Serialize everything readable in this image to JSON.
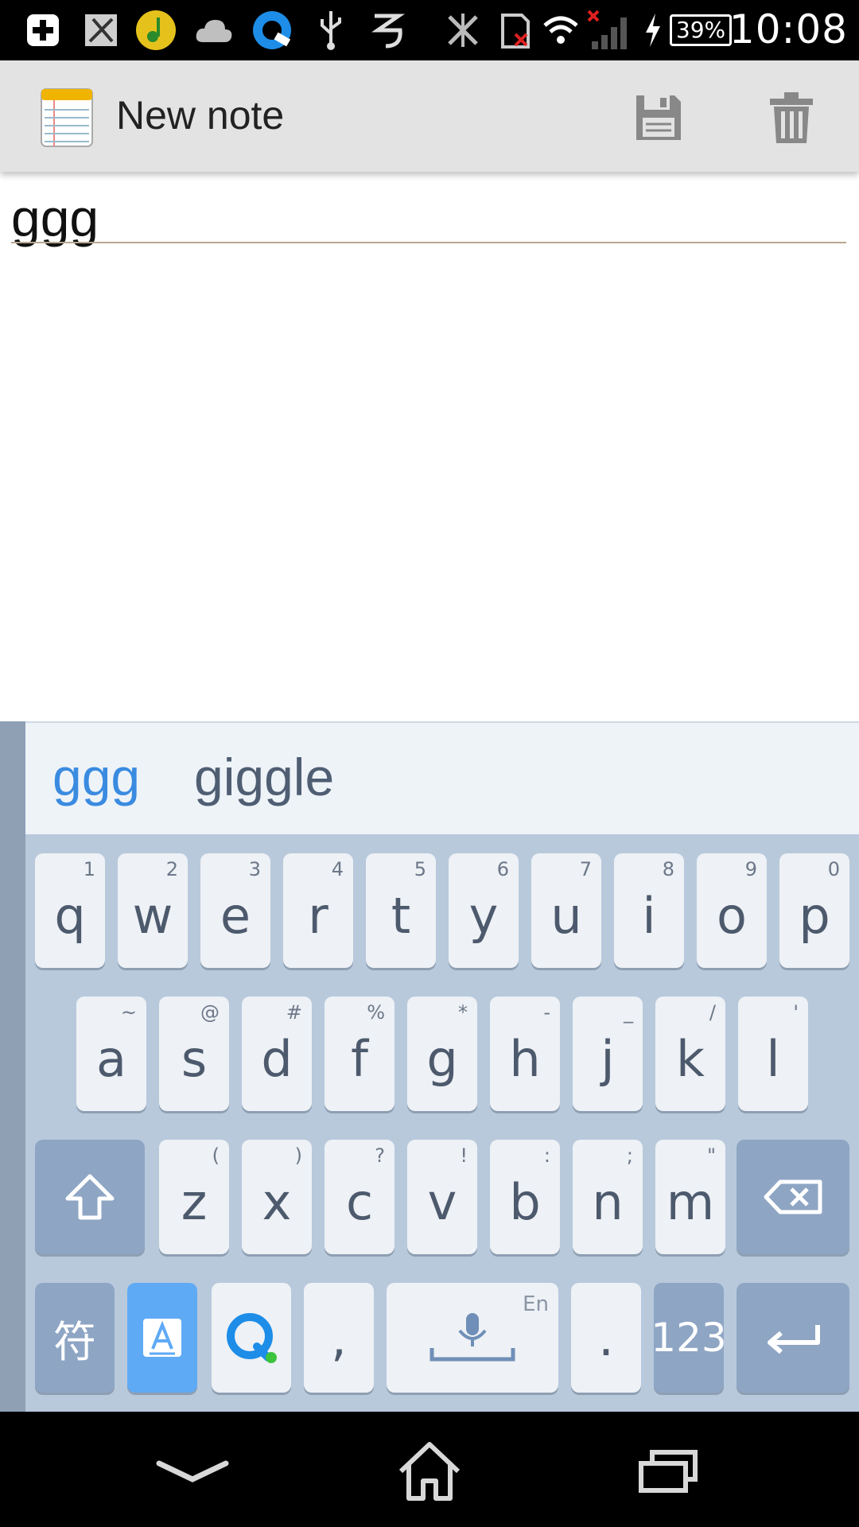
{
  "status_bar": {
    "time": "10:08",
    "battery": "39%",
    "icons": [
      "plus-box-icon",
      "clipboard-cut-icon",
      "music-app-icon",
      "cloud-icon",
      "browser-q-icon",
      "usb-icon",
      "swirl-app-icon",
      "bluetooth-off-icon",
      "sdcard-error-icon",
      "wifi-icon",
      "signal-no-sim-icon",
      "charging-icon"
    ]
  },
  "action_bar": {
    "title": "New note",
    "app_icon": "notepad-icon",
    "save_icon": "save-icon",
    "delete_icon": "trash-icon"
  },
  "note": {
    "text": "ggg"
  },
  "keyboard": {
    "suggestions": [
      "ggg",
      "giggle"
    ],
    "row1": [
      {
        "label": "q",
        "hint": "1"
      },
      {
        "label": "w",
        "hint": "2"
      },
      {
        "label": "e",
        "hint": "3"
      },
      {
        "label": "r",
        "hint": "4"
      },
      {
        "label": "t",
        "hint": "5"
      },
      {
        "label": "y",
        "hint": "6"
      },
      {
        "label": "u",
        "hint": "7"
      },
      {
        "label": "i",
        "hint": "8"
      },
      {
        "label": "o",
        "hint": "9"
      },
      {
        "label": "p",
        "hint": "0"
      }
    ],
    "row2": [
      {
        "label": "a",
        "hint": "~"
      },
      {
        "label": "s",
        "hint": "@"
      },
      {
        "label": "d",
        "hint": "#"
      },
      {
        "label": "f",
        "hint": "%"
      },
      {
        "label": "g",
        "hint": "*"
      },
      {
        "label": "h",
        "hint": "-"
      },
      {
        "label": "j",
        "hint": "_"
      },
      {
        "label": "k",
        "hint": "/"
      },
      {
        "label": "l",
        "hint": "'"
      }
    ],
    "row3": [
      {
        "label": "z",
        "hint": "("
      },
      {
        "label": "x",
        "hint": ")"
      },
      {
        "label": "c",
        "hint": "?"
      },
      {
        "label": "v",
        "hint": "!"
      },
      {
        "label": "b",
        "hint": ":"
      },
      {
        "label": "n",
        "hint": ";"
      },
      {
        "label": "m",
        "hint": "\""
      }
    ],
    "symbols_label": "符",
    "comma_label": ",",
    "space_hint": "En",
    "period_label": ".",
    "numbers_label": "123",
    "colors": {
      "accent": "#3a8be0",
      "key_bg": "#eef1f5",
      "dark_key_bg": "#8ea5c4",
      "keyboard_bg": "#b8c9dc",
      "highlight_key_bg": "#5faaf5"
    }
  },
  "nav_bar": {
    "icons": [
      "back-chevron-icon",
      "home-icon",
      "recents-icon"
    ]
  }
}
